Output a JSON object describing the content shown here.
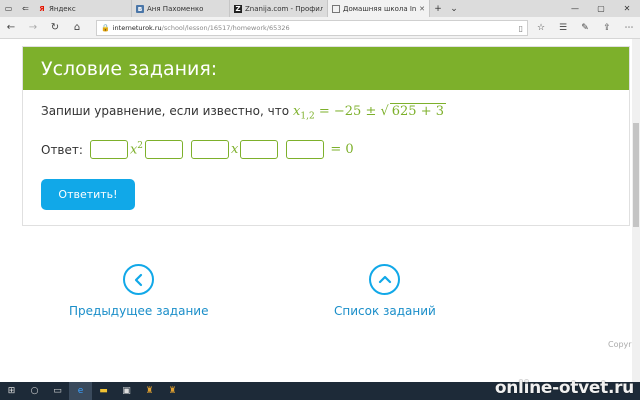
{
  "browser": {
    "tabs": [
      {
        "title": "Яндекс",
        "favicon": "yandex-icon"
      },
      {
        "title": "Аня Пахоменко",
        "favicon": "vk-icon"
      },
      {
        "title": "Znanija.com - Профиль пол",
        "favicon": "znanija-icon"
      },
      {
        "title": "Домашняя школа Inter",
        "favicon": "page-icon"
      }
    ],
    "address": {
      "host": "interneturok.ru",
      "path": "/school/lesson/16517/homework/65326"
    }
  },
  "task": {
    "header": "Условие задания:",
    "prompt": "Запиши уравнение, если известно, что",
    "formula": {
      "var": "x",
      "sub": "1,2",
      "lhs_rest": "= −25 ±",
      "radicand": "625 + 3"
    },
    "answer_label": "Ответ:",
    "answer_terms": {
      "x": "x",
      "sq": "2",
      "eq": "= 0"
    },
    "submit_label": "Ответить!"
  },
  "nav": {
    "prev_label": "Предыдущее задание",
    "list_label": "Список заданий"
  },
  "footer": {
    "copyright": "Copyr"
  },
  "watermark": "online-otvet.ru",
  "colors": {
    "green": "#7db02b",
    "blue": "#11a8e8"
  }
}
